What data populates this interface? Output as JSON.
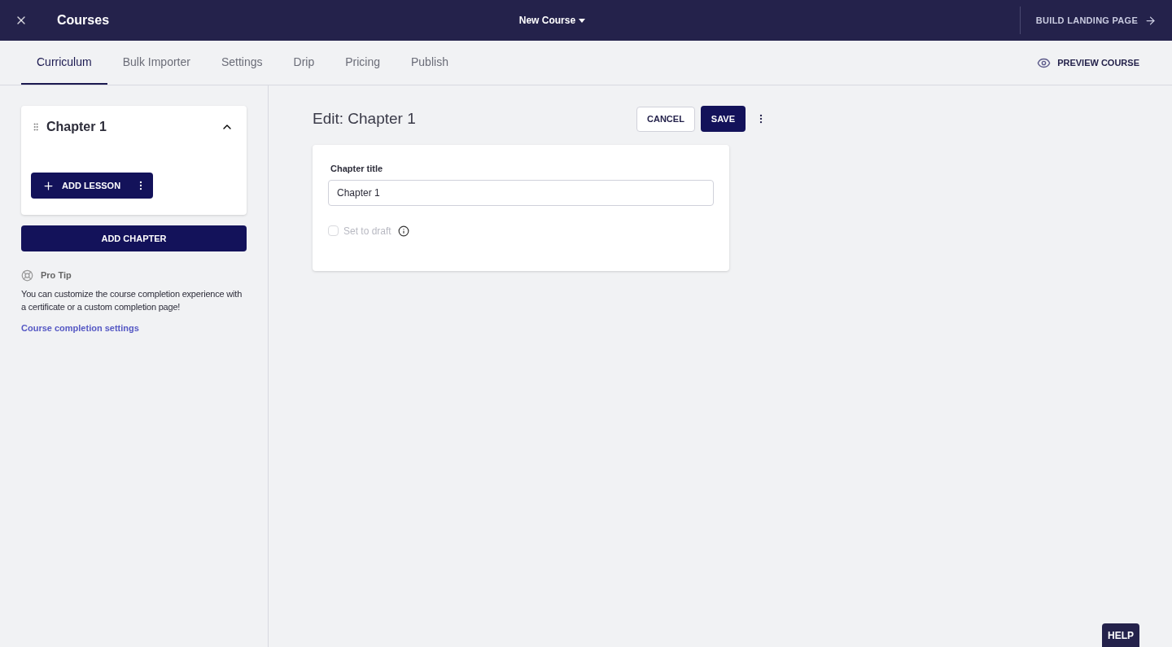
{
  "header": {
    "title": "Courses",
    "course_menu": "New Course",
    "build_link": "BUILD LANDING PAGE"
  },
  "tabs": [
    {
      "label": "Curriculum",
      "selected": true
    },
    {
      "label": "Bulk Importer",
      "selected": false
    },
    {
      "label": "Settings",
      "selected": false
    },
    {
      "label": "Drip",
      "selected": false
    },
    {
      "label": "Pricing",
      "selected": false
    },
    {
      "label": "Publish",
      "selected": false
    }
  ],
  "preview_button": "PREVIEW COURSE",
  "sidebar": {
    "chapters": [
      {
        "title": "Chapter 1",
        "expanded": true,
        "add_lesson": "ADD LESSON"
      }
    ],
    "add_chapter": "ADD CHAPTER",
    "pro_tip": {
      "title": "Pro Tip",
      "text": "You can customize the course completion experience with a certificate or a custom completion page!",
      "link": "Course completion settings"
    }
  },
  "editor": {
    "title": "Edit: Chapter 1",
    "cancel": "CANCEL",
    "save": "SAVE",
    "field_label": "Chapter title",
    "field_value": "Chapter 1",
    "draft": {
      "label": "Set to draft",
      "checked": false,
      "disabled": true
    }
  },
  "help_button": "HELP"
}
